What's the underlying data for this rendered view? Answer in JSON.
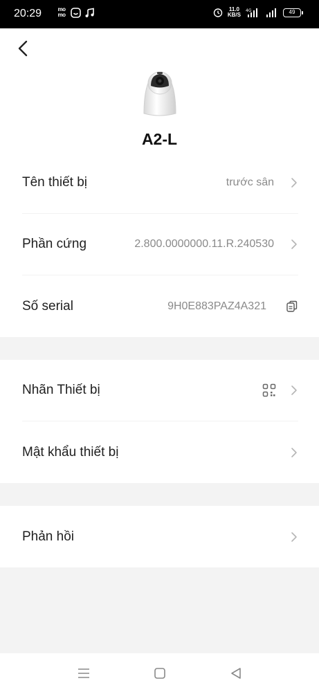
{
  "status_bar": {
    "time": "20:29",
    "notif_mini": [
      "mo\nmo"
    ],
    "speed_value": "11.0",
    "speed_unit": "KB/S",
    "network": "4G",
    "battery": "49"
  },
  "header": {
    "back_icon": "chevron-left-icon",
    "device_name": "A2-L"
  },
  "info_section": [
    {
      "label": "Tên thiết bị",
      "value": "trước sân"
    },
    {
      "label": "Phần cứng",
      "value": "2.800.0000000.11.R.240530"
    },
    {
      "label": "Số serial",
      "value": "9H0E883PAZ4A321"
    }
  ],
  "device_section": [
    {
      "label": "Nhãn Thiết bị",
      "icon": "qr-code-icon"
    },
    {
      "label": "Mật khẩu thiết bị"
    }
  ],
  "feedback_section": [
    {
      "label": "Phản hồi"
    }
  ],
  "colors": {
    "background": "#f3f3f3",
    "card": "#ffffff",
    "label": "#1f1f1f",
    "value": "#8a8a8a",
    "chevron": "#b5b5b5"
  }
}
